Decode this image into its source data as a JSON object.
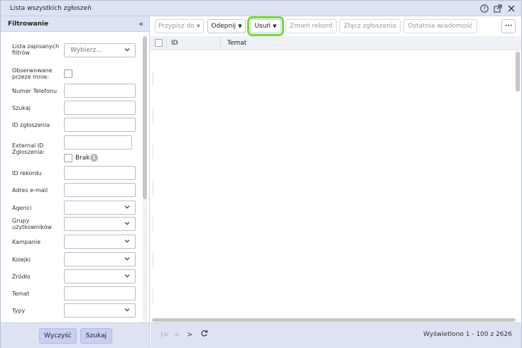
{
  "window": {
    "title": "Lista wszystkich zgłoszeń"
  },
  "filter_panel": {
    "title": "Filtrowanie",
    "saved_filters": {
      "label": "Lista zapisanych filtrów",
      "placeholder": "Wybierz..."
    },
    "observed": {
      "label": "Obserwowane przeze mnie:"
    },
    "phone": {
      "label": "Numer Telefonu"
    },
    "search": {
      "label": "Szukaj"
    },
    "ticket_id": {
      "label": "ID zgłoszenia"
    },
    "external_id": {
      "label": "External ID Zgłoszenia:",
      "none_label": "Brak"
    },
    "record_id": {
      "label": "ID rekordu"
    },
    "email": {
      "label": "Adres e-mail"
    },
    "agents": {
      "label": "Agenci"
    },
    "user_groups": {
      "label": "Grupy użytkowników"
    },
    "campaigns": {
      "label": "Kampanie"
    },
    "queues": {
      "label": "Kolejki"
    },
    "source": {
      "label": "Źródło"
    },
    "subject": {
      "label": "Temat"
    },
    "types": {
      "label": "Typy"
    },
    "clear_button": "Wyczyść",
    "search_button": "Szukaj"
  },
  "toolbar": {
    "assign": "Przypisz do",
    "unpin": "Odepnij",
    "delete": "Usuń",
    "change_record": "Zmień rekord",
    "merge": "Złącz zgłoszenia",
    "last_message": "Ostatnia wiadomość",
    "more": "···"
  },
  "table": {
    "columns": [
      "ID",
      "Temat"
    ]
  },
  "footer": {
    "status": "Wyświetlono 1 - 100 z 2626"
  }
}
